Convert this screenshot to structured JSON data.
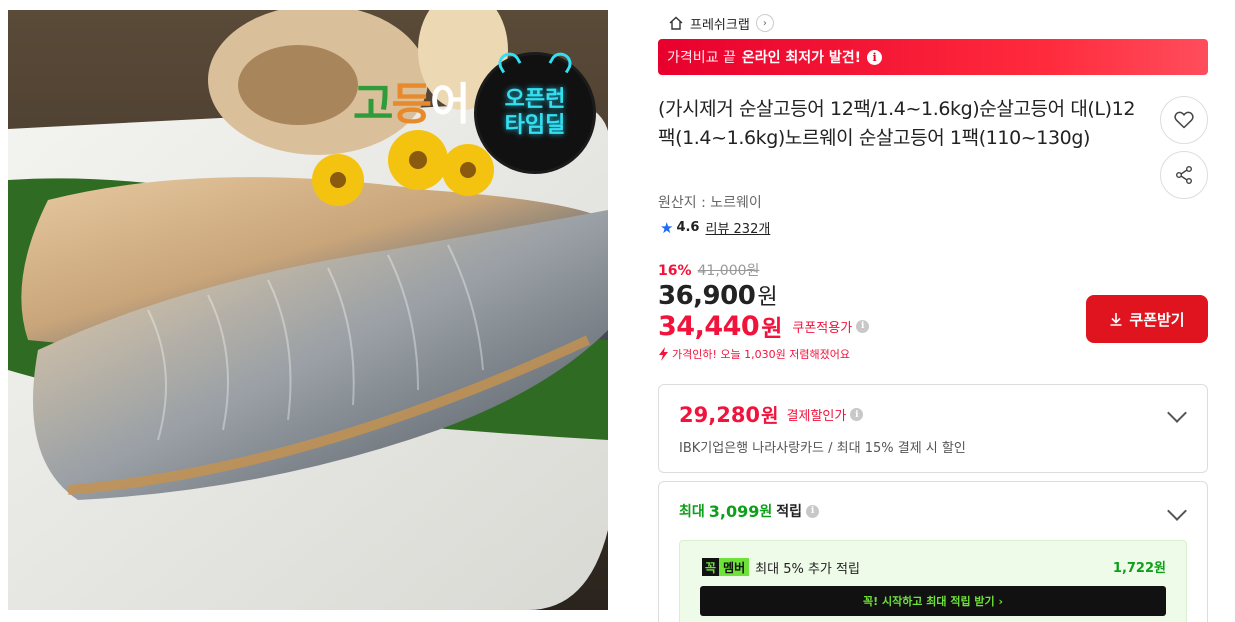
{
  "image": {
    "logo_parts": [
      "고",
      "등",
      "어"
    ],
    "badge_lines": [
      "오픈런",
      "타임딜"
    ],
    "icon": "clock-icon"
  },
  "seller": {
    "icon": "home-icon",
    "name": "프레쉬크랩",
    "chevron": "chevron-right-icon"
  },
  "promo": {
    "prefix": "가격비교 끝",
    "highlight": "온라인 최저가 발견!",
    "icon": "info-icon",
    "color": "#e8002d"
  },
  "product": {
    "title": "(가시제거 순살고등어 12팩/1.4~1.6kg)순살고등어 대(L)12팩(1.4~1.6kg)노르웨이 순살고등어 1팩(110~130g)",
    "origin": "원산지 : 노르웨이",
    "rating": "4.6",
    "review": "리뷰 232개"
  },
  "actions": {
    "like_icon": "heart-icon",
    "share_icon": "share-icon"
  },
  "pricing": {
    "discount_rate": "16%",
    "original_price": "41,000원",
    "price": "36,900",
    "price_unit": "원",
    "coupon_price": "34,440",
    "coupon_unit": "원",
    "coupon_label": "쿠폰적용가",
    "price_drop": "가격인하! 오늘 1,030원 저렴해졌어요",
    "accent": "#f2133c"
  },
  "coupon_button": {
    "label": "쿠폰받기",
    "icon": "download-icon",
    "color": "#e0141e"
  },
  "card_discount": {
    "amount": "29,280",
    "unit": "원",
    "label": "결제할인가",
    "desc": "IBK기업은행 나라사랑카드 / 최대 15% 결제 시 할인"
  },
  "points": {
    "prefix": "최대",
    "amount": "3,099",
    "unit": "원",
    "label": "적립",
    "color": "#0e9f1a"
  },
  "membership": {
    "logo_a": "꼭",
    "logo_b": "멤버",
    "desc": "최대 5% 추가 적립",
    "points": "1,722원",
    "cta": "꼭! 시작하고 최대 적립 받기  ›"
  }
}
